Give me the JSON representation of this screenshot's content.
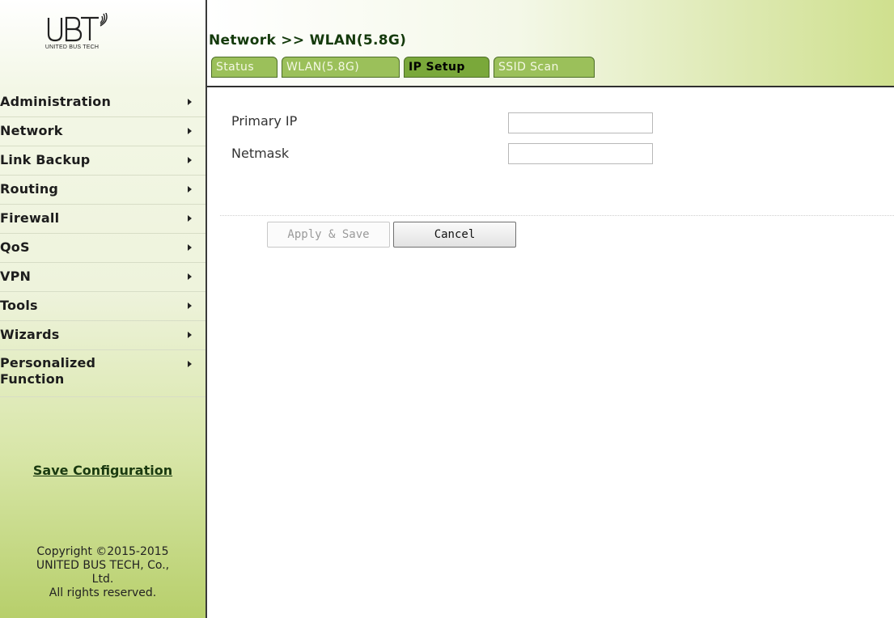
{
  "logo": {
    "mark": "UBT",
    "subtitle": "UNITED BUS TECH",
    "icon": "wifi-signal-icon"
  },
  "sidebar": {
    "items": [
      {
        "label": "Administration"
      },
      {
        "label": "Network"
      },
      {
        "label": "Link Backup"
      },
      {
        "label": "Routing"
      },
      {
        "label": "Firewall"
      },
      {
        "label": "QoS"
      },
      {
        "label": "VPN"
      },
      {
        "label": "Tools"
      },
      {
        "label": "Wizards"
      },
      {
        "label": "Personalized Function"
      }
    ],
    "save_link": "Save Configuration",
    "copyright": [
      "Copyright ©2015-2015",
      "UNITED BUS TECH, Co.,",
      "Ltd.",
      "All rights reserved."
    ]
  },
  "header": {
    "breadcrumb": "Network >> WLAN(5.8G)",
    "tabs": [
      {
        "label": "Status",
        "active": false
      },
      {
        "label": "WLAN(5.8G)",
        "active": false
      },
      {
        "label": "IP Setup",
        "active": true
      },
      {
        "label": "SSID Scan",
        "active": false
      }
    ]
  },
  "form": {
    "primary_ip": {
      "label": "Primary IP",
      "value": ""
    },
    "netmask": {
      "label": "Netmask",
      "value": ""
    },
    "apply_label": "Apply & Save",
    "cancel_label": "Cancel"
  },
  "colors": {
    "tab_bg": "#9bc05a",
    "tab_active_bg": "#7aa83a",
    "sidebar_bottom": "#b7cf6b",
    "breadcrumb_text": "#143a0c"
  }
}
